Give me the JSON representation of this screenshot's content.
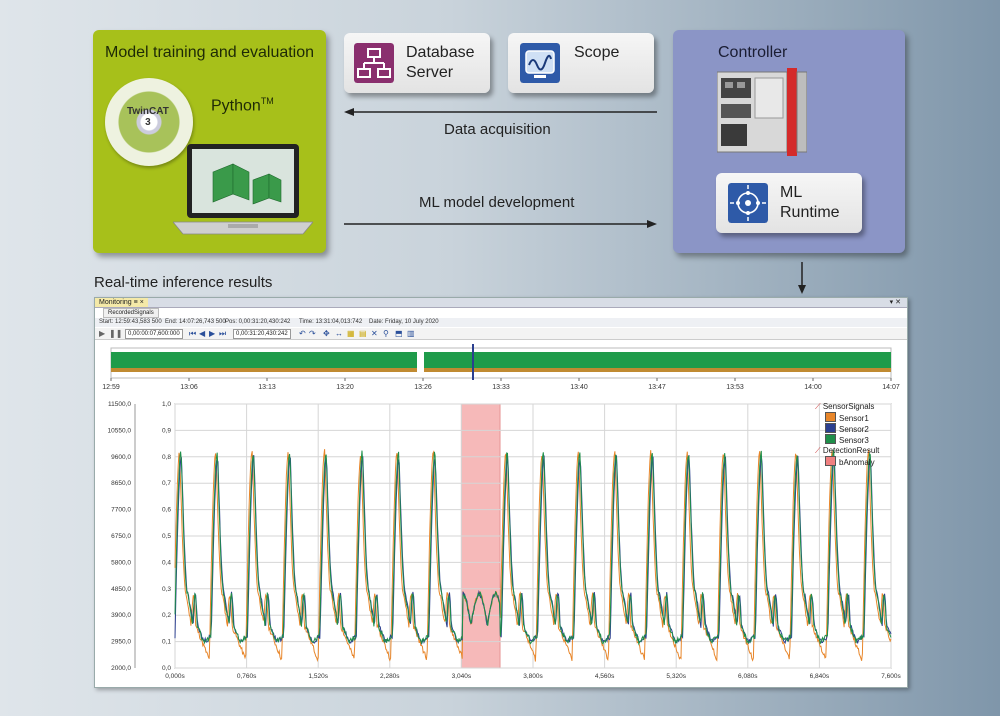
{
  "training_box": {
    "title": "Model training and evaluation",
    "python_label": "Python",
    "python_sup": "TM",
    "cd_label_line1": "TwinCAT",
    "cd_label_line2": "3"
  },
  "database_card": {
    "line1": "Database",
    "line2": "Server",
    "icon": "database-network-icon"
  },
  "scope_card": {
    "label": "Scope",
    "icon": "scope-icon"
  },
  "controller_box": {
    "title": "Controller",
    "ml_line1": "ML",
    "ml_line2": "Runtime",
    "ml_icon": "neural-network-icon"
  },
  "arrows": {
    "data_acquisition": "Data acquisition",
    "ml_model_development": "ML model development"
  },
  "section_title": "Real-time inference results",
  "monitor": {
    "tab": "Monitoring",
    "tab_pin": "≡",
    "tab_close": "×",
    "subtab": "RecordedSignals",
    "info": {
      "start": "Start:   12:59:43,583 500",
      "end": "End:   14:07:26,743 500",
      "pos": "Pos:   0,00:31:20,430:242",
      "time": "Time:   13:31:04,013:742",
      "date": "Date:   Friday, 10 July 2020"
    },
    "toolbar_field1": "0,00:00:07,600:000",
    "toolbar_field2": "0,00:31:20,430:242",
    "overview_ticks": [
      "12:59",
      "13:06",
      "13:13",
      "13:20",
      "13:26",
      "13:33",
      "13:40",
      "13:47",
      "13:53",
      "14:00",
      "14:07"
    ],
    "left_axis": [
      "11500,0",
      "10550,0",
      "9600,0",
      "8650,0",
      "7700,0",
      "6750,0",
      "5800,0",
      "4850,0",
      "3900,0",
      "2950,0",
      "2000,0"
    ],
    "right_axis": [
      "1,0",
      "0,9",
      "0,8",
      "0,7",
      "0,6",
      "0,5",
      "0,4",
      "0,3",
      "0,2",
      "0,1",
      "0,0"
    ],
    "x_ticks": [
      "0,000s",
      "0,760s",
      "1,520s",
      "2,280s",
      "3,040s",
      "3,800s",
      "4,560s",
      "5,320s",
      "6,080s",
      "6,840s",
      "7,600s"
    ],
    "legend": {
      "group1": "SensorSignals",
      "s1": "Sensor1",
      "s2": "Sensor2",
      "s3": "Sensor3",
      "group2": "DetectionResult",
      "s4": "bAnomaly"
    },
    "colors": {
      "sensor1": "#e8862a",
      "sensor2": "#2b3f8f",
      "sensor3": "#1f8f4a",
      "anomaly": "#f08080"
    }
  }
}
